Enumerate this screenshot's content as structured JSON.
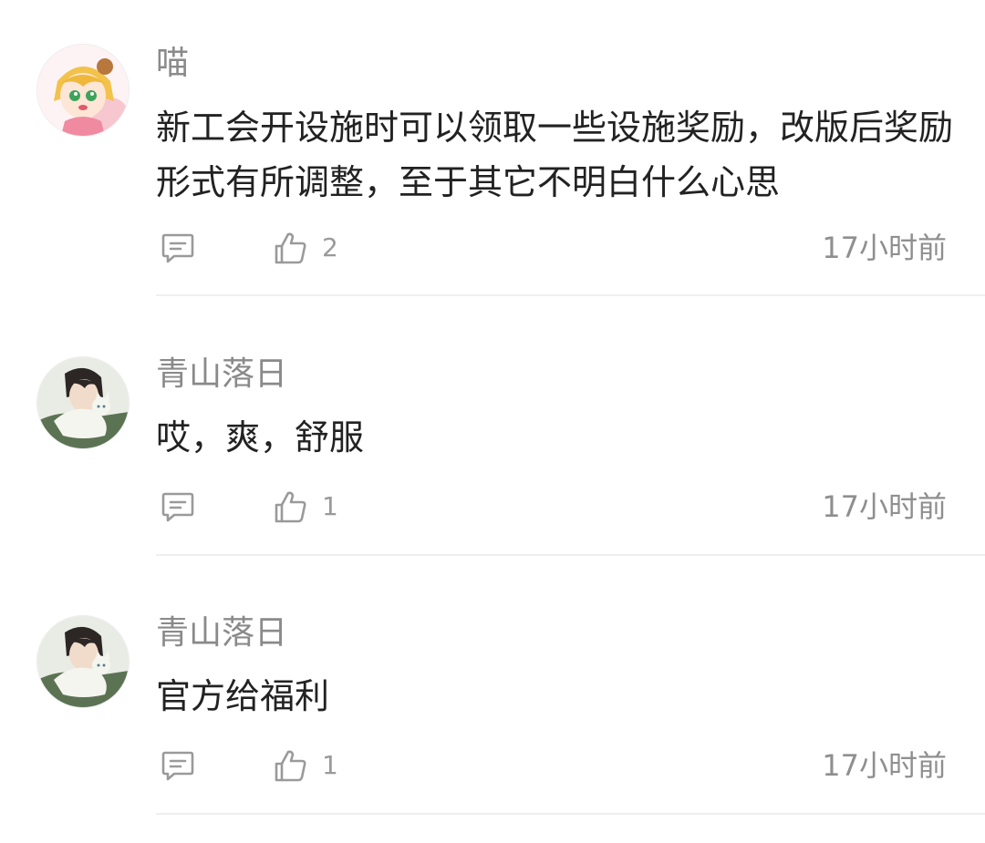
{
  "comments": [
    {
      "username": "喵",
      "content": "新工会开设施时可以领取一些设施奖励，改版后奖励形式有所调整，至于其它不明白什么心思",
      "likes": "2",
      "time": "17小时前",
      "avatar": "anime-girl-avatar"
    },
    {
      "username": "青山落日",
      "content": "哎，爽，舒服",
      "likes": "1",
      "time": "17小时前",
      "avatar": "boy-with-cat-avatar"
    },
    {
      "username": "青山落日",
      "content": "官方给福利",
      "likes": "1",
      "time": "17小时前",
      "avatar": "boy-with-cat-avatar"
    }
  ],
  "icons": {
    "reply": "comment-reply-icon",
    "like": "thumbs-up-icon"
  },
  "colors": {
    "username": "#8a8a8a",
    "content": "#222222",
    "meta": "#8f8f8f",
    "divider": "#efefef"
  }
}
